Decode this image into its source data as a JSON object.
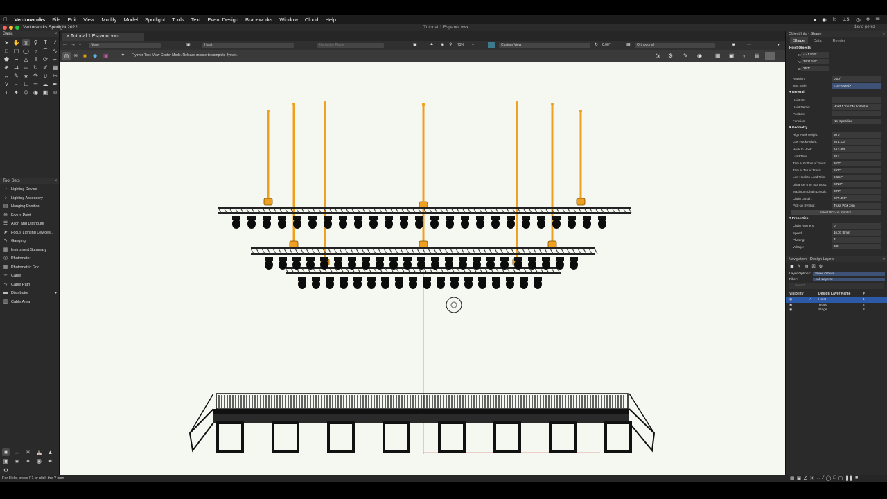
{
  "menubar": {
    "app": "Vectorworks",
    "items": [
      "File",
      "Edit",
      "View",
      "Modify",
      "Model",
      "Spotlight",
      "Tools",
      "Text",
      "Event Design",
      "Braceworks",
      "Window",
      "Cloud",
      "Help"
    ],
    "input_source": "U.S."
  },
  "window": {
    "app_title": "Vectorworks Spotlight 2022",
    "doc_title": "Tutorial 1 Espanol.vwx",
    "user": "david perez"
  },
  "tabs": {
    "doc_tab": "Tutorial 1 Espanol.vwx"
  },
  "viewbar": {
    "class": "None",
    "layer": "Hoist",
    "active_plane": "No Active Plane",
    "zoom": "73%",
    "view": "Custom View",
    "rotation": "0.00°",
    "projection": "Orthogonal"
  },
  "modebar": {
    "hint": "Flyover Tool: View Center Mode. Release mouse to complete flyover."
  },
  "left_panel": {
    "basic_title": "Basic",
    "toolsets_title": "Tool Sets",
    "tool_sets": [
      "Lighting Device",
      "Lighting Accessory",
      "Hanging Position",
      "Focus Point",
      "Align and Distribute",
      "Focus Lighting Devices...",
      "Ganging",
      "Instrument Summary",
      "Photometer",
      "Photometric Grid",
      "Cable",
      "Cable Path",
      "Distributor",
      "Cable Area"
    ]
  },
  "oip": {
    "title": "Object Info - Shape",
    "tabs": [
      "Shape",
      "Data",
      "Render"
    ],
    "object_type": "Hoist Objects",
    "coords": [
      {
        "k": "X:",
        "v": "-141.813\""
      },
      {
        "k": "Y:",
        "v": "34'11 1/2\""
      },
      {
        "k": "Z:",
        "v": "25'7\""
      }
    ],
    "rotation": {
      "k": "Rotation:",
      "v": "0.00°"
    },
    "text_style": {
      "k": "Text Style:",
      "v": "<Un-Styled>"
    },
    "general_title": "General",
    "general": [
      {
        "k": "Hoist ID:",
        "v": ""
      },
      {
        "k": "Hoist Name:",
        "v": "Hoist 1 Ton CM Lodestar"
      },
      {
        "k": "Position:",
        "v": ""
      },
      {
        "k": "Function:",
        "v": "Not Specified"
      }
    ],
    "geometry_title": "Geometry",
    "geometry": [
      {
        "k": "High Hook Height:",
        "v": "50'0\""
      },
      {
        "k": "Low Hook Height:",
        "v": "26'4.134\""
      },
      {
        "k": "Hook to Hook:",
        "v": "23'7.866\""
      },
      {
        "k": "Load Trim:",
        "v": "26'7\""
      },
      {
        "k": "Trim at Bottom of Truss:",
        "v": "26'0\""
      },
      {
        "k": "Trim at Top of Truss:",
        "v": "26'2\""
      },
      {
        "k": "Low Hook to Load Trim:",
        "v": "9.134\""
      },
      {
        "k": "Distance Trim Top Truss:",
        "v": "23'10\""
      },
      {
        "k": "Maximum Chain Length:",
        "v": "80'0\""
      },
      {
        "k": "Chain Length:",
        "v": "22'7.496\""
      },
      {
        "k": "Pick-up Symbol:",
        "v": "Truss Pick 24in"
      }
    ],
    "select_pickup": "Select Pick-up Symbol...",
    "properties_title": "Properties",
    "properties": [
      {
        "k": "Chain Runners:",
        "v": "0"
      },
      {
        "k": "Speed:",
        "v": "16.01 ft/min"
      },
      {
        "k": "Phasing:",
        "v": "3"
      },
      {
        "k": "Voltage:",
        "v": "208"
      }
    ]
  },
  "nav": {
    "title": "Navigation - Design Layers",
    "layer_options_label": "Layer Options:",
    "layer_options_value": "Show Others",
    "filter_label": "Filter:",
    "filter_value": "<All Layers>",
    "search_placeholder": "Search",
    "col_visibility": "Visibility",
    "col_name": "Design Layer Name",
    "col_num": "#",
    "layers": [
      {
        "name": "Hoist",
        "num": "1"
      },
      {
        "name": "Truss",
        "num": "2"
      },
      {
        "name": "Stage",
        "num": "3"
      }
    ]
  },
  "status": {
    "help": "For Help, press F1 or click the ? icon"
  },
  "colors": {
    "hoist": "#f0a020",
    "canvas": "#f4f8f1",
    "selected_layer": "#2d5aa8"
  }
}
